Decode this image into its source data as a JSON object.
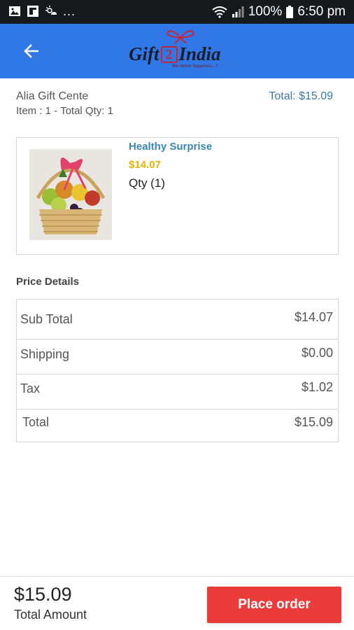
{
  "status_bar": {
    "left_icons": [
      "image-icon",
      "flipboard-icon",
      "weather-icon"
    ],
    "dots": "...",
    "battery": "100%",
    "time": "6:50 pm"
  },
  "app_bar": {
    "back_icon": "arrow-left-icon",
    "logo": {
      "part1": "Gift",
      "part2": "2",
      "part3": "India",
      "tagline": "We deliver happiness...!!"
    }
  },
  "order": {
    "store_name": "Alia Gift Cente",
    "item_summary": "Item : 1 - Total Qty: 1",
    "total": "Total: $15.09"
  },
  "product": {
    "name": "Healthy Surprise",
    "price": "$14.07",
    "qty": "Qty (1)"
  },
  "price_details": {
    "heading": "Price Details",
    "rows": [
      {
        "label": "Sub Total",
        "value": "$14.07"
      },
      {
        "label": "Shipping",
        "value": "$0.00"
      },
      {
        "label": "Tax",
        "value": "$1.02"
      },
      {
        "label": "Total",
        "value": "$15.09"
      }
    ]
  },
  "bottom": {
    "amount": "$15.09",
    "label": "Total Amount",
    "button": "Place order"
  },
  "colors": {
    "app_bar": "#2f78e6",
    "product_name": "#3a86b5",
    "product_price": "#e8b400",
    "place_order": "#eb3c3c",
    "total_top": "#3b78a8"
  }
}
